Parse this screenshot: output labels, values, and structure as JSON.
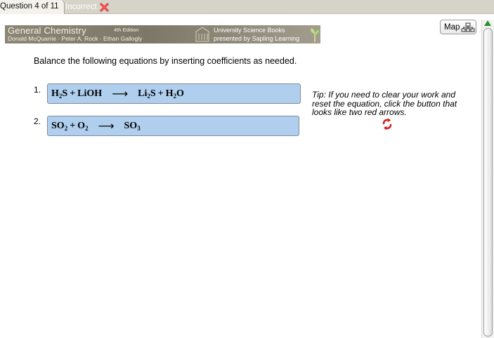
{
  "tabs": {
    "question_label": "Question 4 of 11",
    "status_label": "Incorrect"
  },
  "banner": {
    "title": "General Chemistry",
    "edition": "4th Edition",
    "authors": "Donald McQuarrie · Peter A. Rock · Ethan Gallogly",
    "publisher_line1": "University Science Books",
    "publisher_line2": "presented by Sapling Learning"
  },
  "map_button": {
    "label": "Map",
    "icon": "map-tree-icon"
  },
  "instructions": "Balance the following equations by inserting coefficients as needed.",
  "questions": [
    {
      "number": "1.",
      "reactants": [
        {
          "base": "H",
          "sub": "2",
          "tail": "S"
        },
        {
          "base": "LiOH"
        }
      ],
      "products": [
        {
          "base": "Li",
          "sub": "2",
          "tail": "S"
        },
        {
          "base": "H",
          "sub": "2",
          "tail": "O"
        }
      ]
    },
    {
      "number": "2.",
      "reactants": [
        {
          "base": "SO",
          "sub": "2"
        },
        {
          "base": "O",
          "sub": "2"
        }
      ],
      "products": [
        {
          "base": "SO",
          "sub": "3"
        }
      ]
    }
  ],
  "tip": "Tip: If you need to clear your work and reset the equation, click the button that looks like two red arrows.",
  "colors": {
    "equation_box": "#b0cfee",
    "banner": "#7d7767",
    "incorrect_x": "#e02020",
    "reset_arrows": "#d42020",
    "scroll_arrow": "#2d8f2d"
  }
}
